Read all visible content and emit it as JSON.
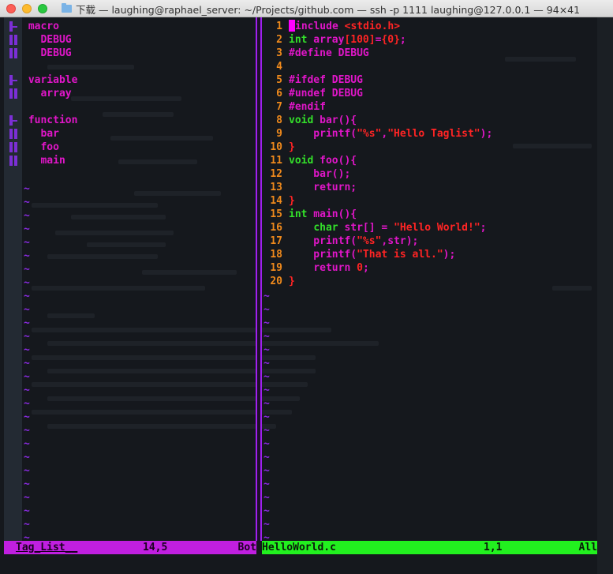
{
  "window": {
    "title": "下载 — laughing@raphael_server: ~/Projects/github.com — ssh -p 1111 laughing@127.0.0.1 — 94×41"
  },
  "colors": {
    "folder_accent": "#a020f0",
    "status_left_bg": "#c01fe0",
    "status_right_bg": "#22f01f",
    "line_number": "#f08a1c",
    "keyword": "#e016c8",
    "type": "#33e02a",
    "string": "#ff2424"
  },
  "taglist": {
    "lines": [
      {
        "marker": "-",
        "text": " macro"
      },
      {
        "marker": "|",
        "text": "   DEBUG"
      },
      {
        "marker": "|",
        "text": "   DEBUG"
      },
      {
        "marker": "",
        "text": ""
      },
      {
        "marker": "-",
        "text": " variable"
      },
      {
        "marker": "|",
        "text": "   array"
      },
      {
        "marker": "",
        "text": ""
      },
      {
        "marker": "-",
        "text": " function"
      },
      {
        "marker": "|",
        "text": "   bar"
      },
      {
        "marker": "|",
        "text": "   foo"
      },
      {
        "marker": "|",
        "text": "   main"
      }
    ],
    "tilde": "~"
  },
  "editor": {
    "line_numbers": [
      "1",
      "2",
      "3",
      "4",
      "5",
      "6",
      "7",
      "8",
      "9",
      "10",
      "11",
      "12",
      "13",
      "14",
      "15",
      "16",
      "17",
      "18",
      "19",
      "20"
    ],
    "lines": [
      "#include <stdio.h>",
      "int array[100]={0};",
      "#define DEBUG",
      "",
      "#ifdef DEBUG",
      "#undef DEBUG",
      "#endif",
      "void bar(){",
      "    printf(\"%s\",\"Hello Taglist\");",
      "}",
      "void foo(){",
      "    bar();",
      "    return;",
      "}",
      "int main(){",
      "    char str[] = \"Hello World!\";",
      "    printf(\"%s\",str);",
      "    printf(\"That is all.\");",
      "    return 0;",
      "}"
    ],
    "tilde": "~"
  },
  "status": {
    "left_name": "Tag_List__",
    "left_pos": "14,5",
    "left_pct": "Bot",
    "right_name": "HelloWorld.c",
    "right_pos": "1,1",
    "right_pct": "All"
  }
}
